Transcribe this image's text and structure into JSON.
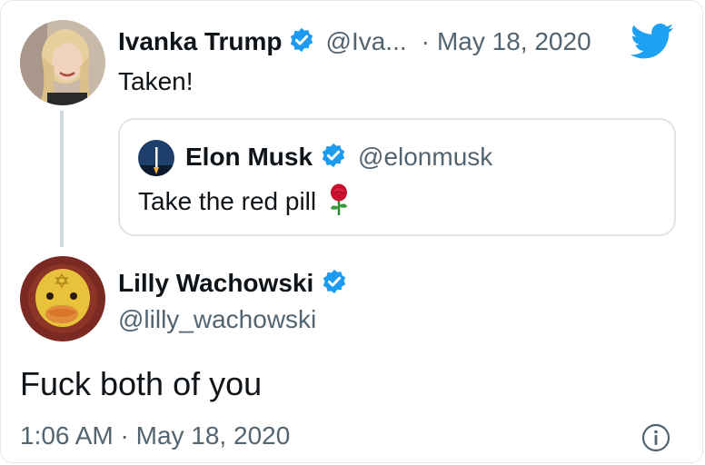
{
  "reply_tweet": {
    "author_name": "Ivanka Trump",
    "author_handle": "@Iva...",
    "separator": "·",
    "date": "May 18, 2020",
    "text": "Taken!",
    "verified": true,
    "platform_icon": "twitter-bird-icon"
  },
  "quoted_tweet": {
    "author_name": "Elon Musk",
    "author_handle": "@elonmusk",
    "text": "Take the red pill",
    "emoji": "🌹",
    "verified": true
  },
  "main_tweet": {
    "author_name": "Lilly Wachowski",
    "author_handle": "@lilly_wachowski",
    "text": "Fuck both of you",
    "timestamp": "1:06 AM · May 18, 2020",
    "verified": true
  },
  "colors": {
    "verified_blue": "#1d9bf0",
    "twitter_blue": "#1da1f2",
    "secondary_text": "#536471",
    "primary_text": "#0f1419"
  },
  "icons": [
    "verified-badge-icon",
    "twitter-bird-icon",
    "info-icon"
  ]
}
